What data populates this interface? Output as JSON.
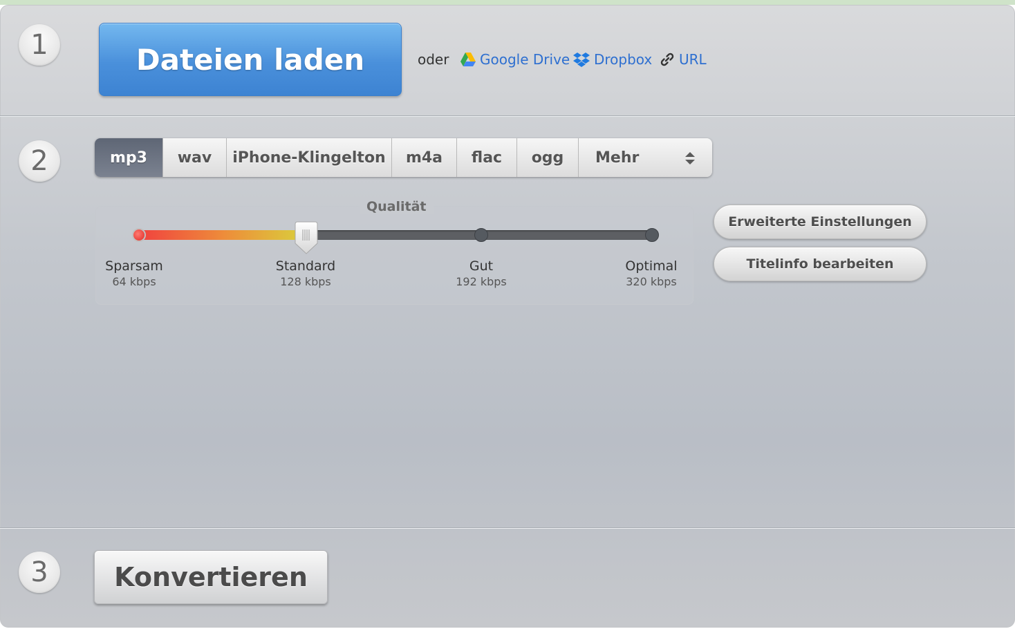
{
  "steps": {
    "one": "1",
    "two": "2",
    "three": "3"
  },
  "upload": {
    "load_label": "Dateien laden",
    "or_label": "oder",
    "google_drive": "Google Drive",
    "dropbox": "Dropbox",
    "url": "URL"
  },
  "formats": {
    "tabs": [
      "mp3",
      "wav",
      "iPhone-Klingelton",
      "m4a",
      "flac",
      "ogg"
    ],
    "selected": "mp3",
    "more_label": "Mehr"
  },
  "quality": {
    "legend": "Qualität",
    "selected_index": 1,
    "levels": [
      {
        "name": "Sparsam",
        "bitrate": "64 kbps"
      },
      {
        "name": "Standard",
        "bitrate": "128 kbps"
      },
      {
        "name": "Gut",
        "bitrate": "192 kbps"
      },
      {
        "name": "Optimal",
        "bitrate": "320 kbps"
      }
    ]
  },
  "side_buttons": {
    "advanced": "Erweiterte Einstellungen",
    "title_info": "Titelinfo bearbeiten"
  },
  "convert_label": "Konvertieren",
  "colors": {
    "link": "#2e6fd0",
    "load_button": "#4a90db",
    "active_tab": "#6b7280",
    "slider_low": "#f0413f",
    "slider_high": "#d9d03c"
  }
}
